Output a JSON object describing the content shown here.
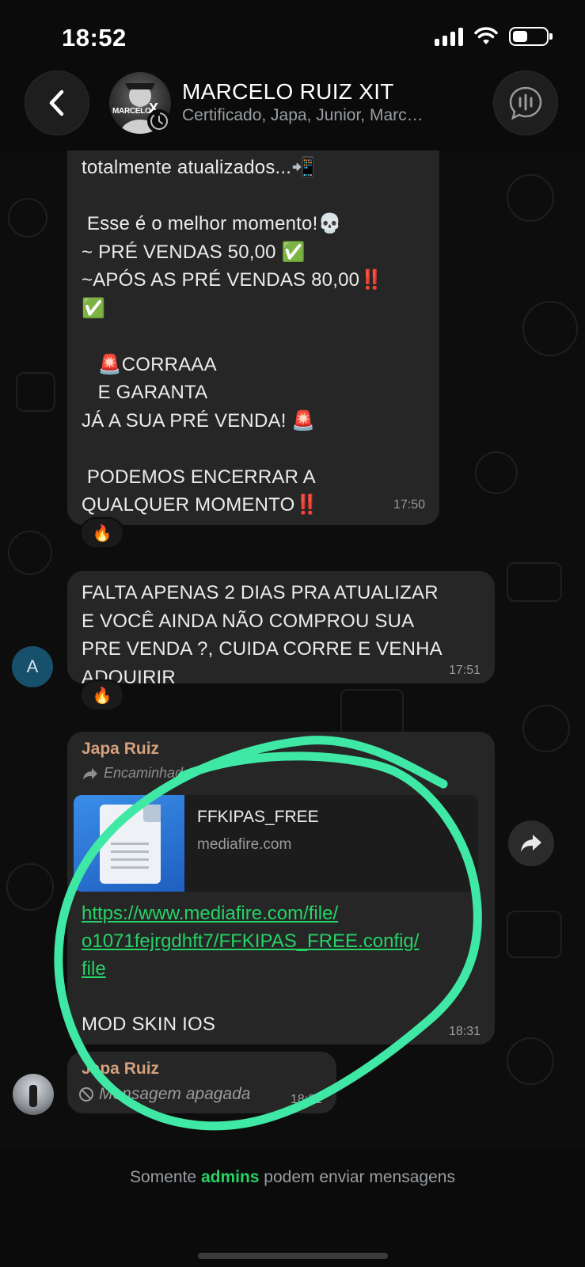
{
  "status_bar": {
    "time": "18:52"
  },
  "header": {
    "title": "MARCELO RUIZ XIT",
    "subtitle": "Certificado, Japa, Junior, Marc…",
    "avatar_text": "MARCELO",
    "avatar_mark": "X"
  },
  "messages": [
    {
      "text": "totalmente atualizados...📲\n\n Esse é o melhor momento!💀\n~ PRÉ VENDAS 50,00 ✅\n~APÓS AS PRÉ VENDAS 80,00‼️\n✅\n\n   🚨CORRAAA\n   E GARANTA\nJÁ A SUA PRÉ VENDA! 🚨\n\n PODEMOS ENCERRAR A\nQUALQUER MOMENTO‼️",
      "time": "17:50",
      "reaction": "🔥"
    },
    {
      "avatar_letter": "A",
      "text": "FALTA APENAS 2 DIAS PRA ATUALIZAR\nE VOCÊ AINDA NÃO COMPROU SUA\nPRE VENDA ?, CUIDA CORRE E VENHA\nADQUIRIR",
      "time": "17:51",
      "reaction": "🔥"
    },
    {
      "sender": "Japa Ruiz",
      "forwarded": "Encaminhada",
      "card_title": "FFKIPAS_FREE",
      "card_domain": "mediafire.com",
      "url_lines": [
        "https://www.mediafire.com/file/",
        "o1071fejrgdhft7/FFKIPAS_FREE.config/",
        "file"
      ],
      "caption": "MOD SKIN IOS",
      "time": "18:31"
    },
    {
      "sender": "Japa Ruiz",
      "deleted_text": "Mensagem apagada",
      "time": "18:31"
    }
  ],
  "footer": {
    "prefix": "Somente ",
    "highlight": "admins",
    "suffix": " podem enviar mensagens"
  },
  "colors": {
    "accent_green": "#25d366",
    "sender_name": "#d5a07c",
    "bubble": "#262626",
    "annotation_circle": "#3fe8a4"
  }
}
